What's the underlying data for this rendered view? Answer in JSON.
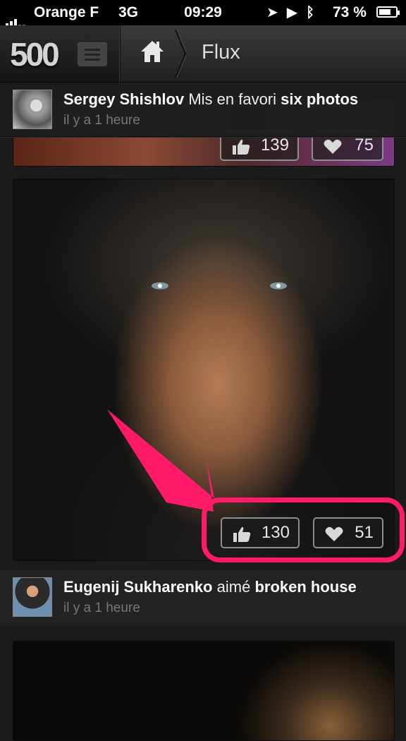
{
  "status_bar": {
    "carrier": "Orange F",
    "network": "3G",
    "time": "09:29",
    "battery": "73 %",
    "battery_level": 0.73
  },
  "nav": {
    "logo": "500",
    "title": "Flux"
  },
  "feed": [
    {
      "user": "Sergey Shishlov",
      "action": "Mis en favori",
      "object": "six photos",
      "time": "il y a 1 heure",
      "likes": "139",
      "favorites": "75"
    },
    {
      "likes": "130",
      "favorites": "51"
    },
    {
      "user": "Eugenij Sukharenko",
      "action": "aimé",
      "object": "broken house",
      "time": "il y a 1 heure"
    }
  ],
  "annotation": {
    "color": "#ff1b6a"
  }
}
